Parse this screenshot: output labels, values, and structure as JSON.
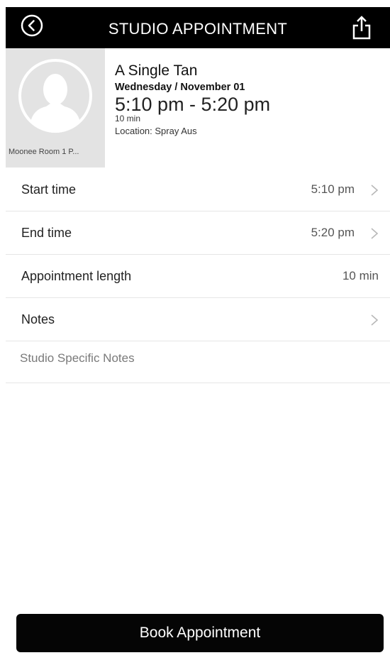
{
  "header": {
    "title": "STUDIO APPOINTMENT",
    "back_icon": "back-circle-icon",
    "share_icon": "share-icon"
  },
  "appointment": {
    "name": "A Single Tan",
    "date": "Wednesday / November 01",
    "time_range": "5:10 pm - 5:20 pm",
    "duration": "10 min",
    "location": "Location: Spray Aus",
    "room": "Moonee Room 1 P..."
  },
  "rows": {
    "start": {
      "label": "Start time",
      "value": "5:10 pm"
    },
    "end": {
      "label": "End time",
      "value": "5:20 pm"
    },
    "length": {
      "label": "Appointment length",
      "value": "10 min"
    },
    "notes": {
      "label": "Notes"
    }
  },
  "notes_placeholder": "Studio Specific Notes",
  "book_button": "Book Appointment"
}
